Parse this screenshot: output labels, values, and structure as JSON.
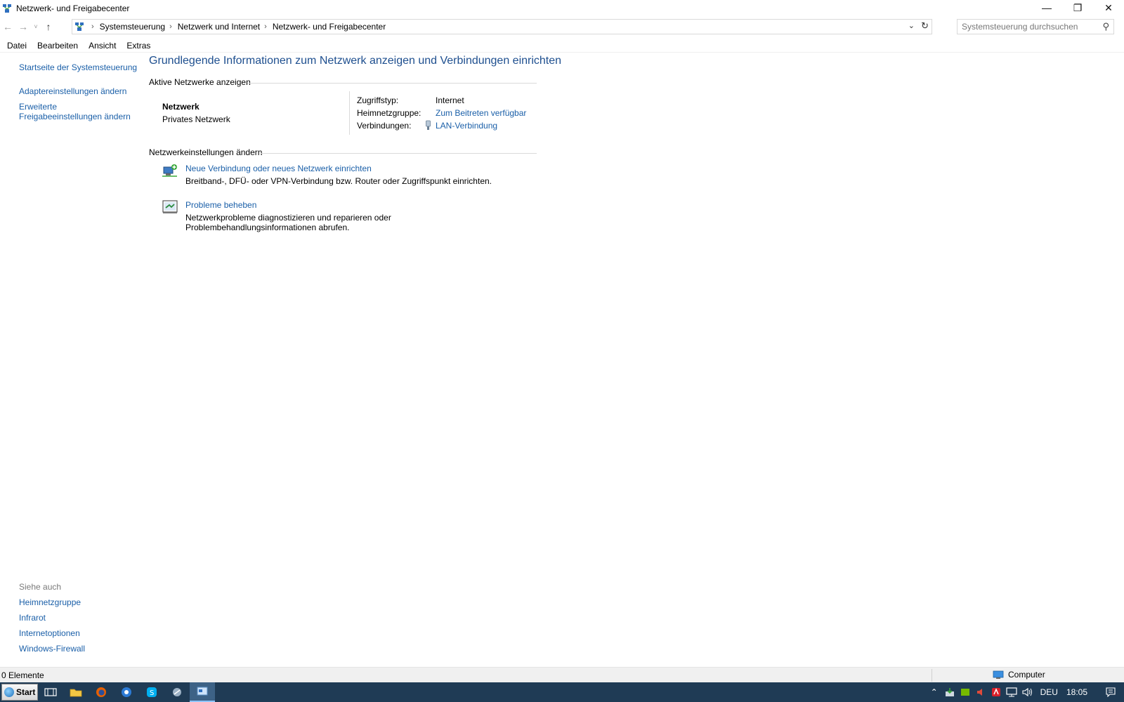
{
  "window": {
    "title": "Netzwerk- und Freigabecenter",
    "minimize_icon": "minimize-icon",
    "restore_icon": "restore-icon",
    "close_icon": "close-icon"
  },
  "address": {
    "breadcrumb": [
      "Systemsteuerung",
      "Netzwerk und Internet",
      "Netzwerk- und Freigabecenter"
    ],
    "search_placeholder": "Systemsteuerung durchsuchen"
  },
  "menu": [
    "Datei",
    "Bearbeiten",
    "Ansicht",
    "Extras"
  ],
  "sidebar": {
    "home_link": "Startseite der Systemsteuerung",
    "links": [
      "Adaptereinstellungen ändern",
      "Erweiterte",
      "Freigabeeinstellungen ändern"
    ],
    "see_also_title": "Siehe auch",
    "see_also": [
      "Heimnetzgruppe",
      "Infrarot",
      "Internetoptionen",
      "Windows-Firewall"
    ]
  },
  "main": {
    "heading": "Grundlegende Informationen zum Netzwerk anzeigen und Verbindungen einrichten",
    "active_section_title": "Aktive Netzwerke anzeigen",
    "network_name": "Netzwerk",
    "network_type": "Privates Netzwerk",
    "props": [
      {
        "label": "Zugriffstyp:",
        "value": "Internet"
      },
      {
        "label": "Heimnetzgruppe:",
        "value": "Zum Beitreten verfügbar"
      },
      {
        "label": "Verbindungen:",
        "value": "LAN-Verbindung"
      }
    ],
    "change_section_title": "Netzwerkeinstellungen ändern",
    "tasks": [
      {
        "link": "Neue Verbindung oder neues Netzwerk einrichten",
        "desc": "Breitband-, DFÜ- oder VPN-Verbindung bzw. Router oder Zugriffspunkt einrichten."
      },
      {
        "link": "Probleme beheben",
        "desc": "Netzwerkprobleme diagnostizieren und reparieren oder Problembehandlungsinformationen abrufen."
      }
    ]
  },
  "status": {
    "count": "0 Elemente",
    "zone": "Computer"
  },
  "taskbar": {
    "start_label": "Start",
    "language": "DEU",
    "time": "18:05"
  }
}
